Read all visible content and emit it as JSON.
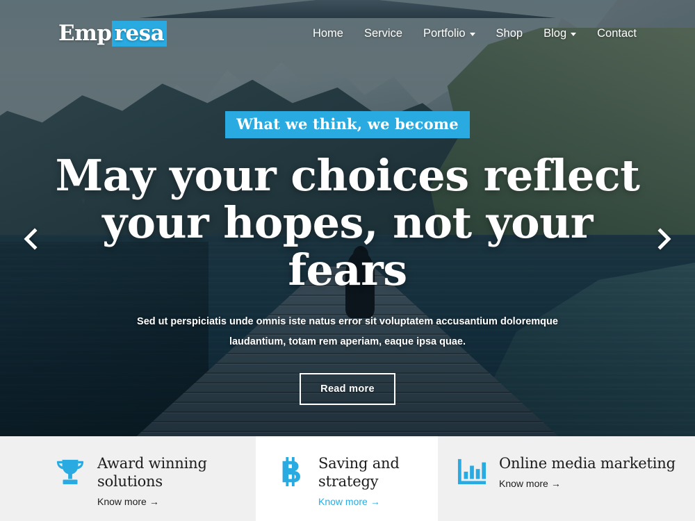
{
  "theme": {
    "accent": "#29abe2",
    "feature_bg": "#f0f0f0",
    "feature_bg_active": "#ffffff",
    "text_dark": "#1c1c1c"
  },
  "header": {
    "logo": {
      "first": "Emp",
      "highlight": "resa"
    },
    "nav": [
      {
        "label": "Home",
        "has_dropdown": false,
        "icon": ""
      },
      {
        "label": "Service",
        "has_dropdown": false,
        "icon": ""
      },
      {
        "label": "Portfolio",
        "has_dropdown": true,
        "icon": "chevron-down-icon"
      },
      {
        "label": "Shop",
        "has_dropdown": false,
        "icon": ""
      },
      {
        "label": "Blog",
        "has_dropdown": true,
        "icon": "chevron-down-icon"
      },
      {
        "label": "Contact",
        "has_dropdown": false,
        "icon": ""
      }
    ]
  },
  "hero": {
    "badge": "What we think, we become",
    "headline": "May your choices reflect your hopes, not your fears",
    "subtitle": "Sed ut perspiciatis unde omnis iste natus error sit voluptatem accusantium doloremque laudantium, totam rem aperiam, eaque ipsa quae.",
    "cta_label": "Read more",
    "prev_icon": "chevron-left-icon",
    "next_icon": "chevron-right-icon",
    "background_description": "Mountain lake with wooden dock and seated silhouette"
  },
  "features": [
    {
      "icon": "trophy-icon",
      "title": "Award winning solutions",
      "link_label": "Know more",
      "link_arrow": "→",
      "active": false
    },
    {
      "icon": "bitcoin-icon",
      "title": "Saving and strategy",
      "link_label": "Know more",
      "link_arrow": "→",
      "active": true
    },
    {
      "icon": "bar-chart-icon",
      "title": "Online media marketing",
      "link_label": "Know more",
      "link_arrow": "→",
      "active": false
    }
  ]
}
